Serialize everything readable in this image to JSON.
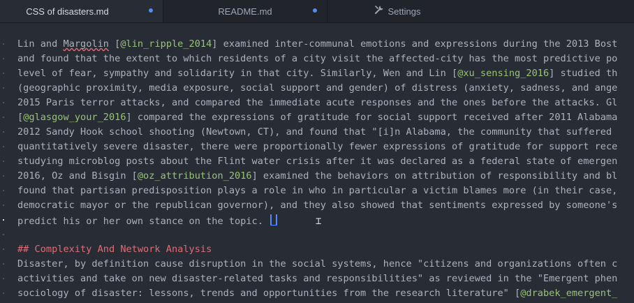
{
  "tabs": [
    {
      "label": "CSS of disasters.md",
      "modified": true,
      "active": true
    },
    {
      "label": "README.md",
      "modified": true,
      "active": false
    },
    {
      "label": "Settings",
      "icon": "wrench-icon",
      "active": false
    }
  ],
  "colors": {
    "background": "#282c34",
    "tabbar": "#21252b",
    "text": "#abb2bf",
    "citation": "#98c379",
    "heading": "#e06c75",
    "modified_dot": "#568af2"
  },
  "editor": {
    "lines": [
      [
        {
          "t": "Lin and "
        },
        {
          "t": "Margolin",
          "c": "spell"
        },
        {
          "t": " ["
        },
        {
          "t": "@lin_ripple_2014",
          "c": "cite"
        },
        {
          "t": "] examined inter-communal emotions and expressions during the 2013 Bost"
        }
      ],
      [
        {
          "t": "and found that the extent to which residents of a city visit the affected-city has the most predictive po"
        }
      ],
      [
        {
          "t": "level of fear, sympathy and solidarity in that city. Similarly, Wen and Lin ["
        },
        {
          "t": "@xu_sensing_2016",
          "c": "cite"
        },
        {
          "t": "] studied th"
        }
      ],
      [
        {
          "t": "(geographic proximity, media exposure, social support and gender) of distress (anxiety, sadness, and ange"
        }
      ],
      [
        {
          "t": "2015 Paris terror attacks, and compared the immediate acute responses and the ones before the attacks. Gl"
        }
      ],
      [
        {
          "t": "["
        },
        {
          "t": "@glasgow_your_2016",
          "c": "cite"
        },
        {
          "t": "] compared the expressions of gratitude for social support received after 2011 Alabama"
        }
      ],
      [
        {
          "t": "2012 Sandy Hook school shooting (Newtown, CT), and found that \"[i]n Alabama, the community that suffered "
        }
      ],
      [
        {
          "t": "quantitatively severe disaster, there were proportionally fewer expressions of gratitude for support rece"
        }
      ],
      [
        {
          "t": "studying microblog posts about the Flint water crisis after it was declared as a federal state of emergen"
        }
      ],
      [
        {
          "t": "2016, Oz and Bisgin ["
        },
        {
          "t": "@oz_attribution_2016",
          "c": "cite"
        },
        {
          "t": "] examined the behaviors on attribution of responsibility and bl"
        }
      ],
      [
        {
          "t": "found that partisan predisposition plays a role in who in particular a victim blames more (in their case,"
        }
      ],
      [
        {
          "t": "democratic mayor or the republican governor), and they also showed that sentiments expressed by someone's"
        }
      ],
      [
        {
          "t": "predict his or her own stance on the topic. "
        },
        {
          "cursor": true
        }
      ],
      [],
      [
        {
          "t": "## Complexity And Network Analysis",
          "c": "heading"
        }
      ],
      [
        {
          "t": "Disaster, by definition cause disruption in the social systems, hence \"citizens and organizations often c"
        }
      ],
      [
        {
          "t": "activities and take on new disaster-related tasks and responsibilities\" as reviewed in the \"Emergent phen"
        }
      ],
      [
        {
          "t": "sociology of disaster: lessons, trends and opportunities from the research literature\" ["
        },
        {
          "t": "@drabek_emergent_",
          "c": "cite"
        }
      ]
    ]
  }
}
